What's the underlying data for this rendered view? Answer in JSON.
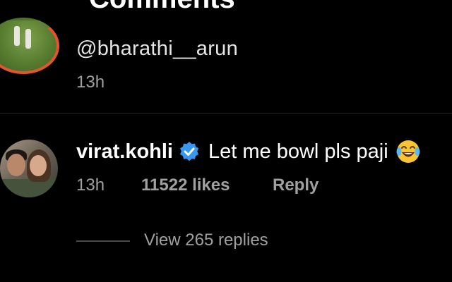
{
  "header": {
    "title": "Comments",
    "back_icon": "arrow-left-icon"
  },
  "previous_comment": {
    "mention": "@bharathi__arun",
    "time": "13h",
    "avatar_ring_color": "#e2552f"
  },
  "main_comment": {
    "username": "virat.kohli",
    "verified_icon": "verified-badge-icon",
    "verified_color": "#3897f0",
    "text": "Let me bowl pls paji",
    "emoji": "face-with-tears-of-joy-icon",
    "time": "13h",
    "likes": "11522 likes",
    "reply_label": "Reply",
    "view_replies": "View 265 replies"
  },
  "colors": {
    "background": "#000000",
    "primary_text": "#ffffff",
    "secondary_text": "#a0a0a0",
    "divider": "#262626"
  }
}
